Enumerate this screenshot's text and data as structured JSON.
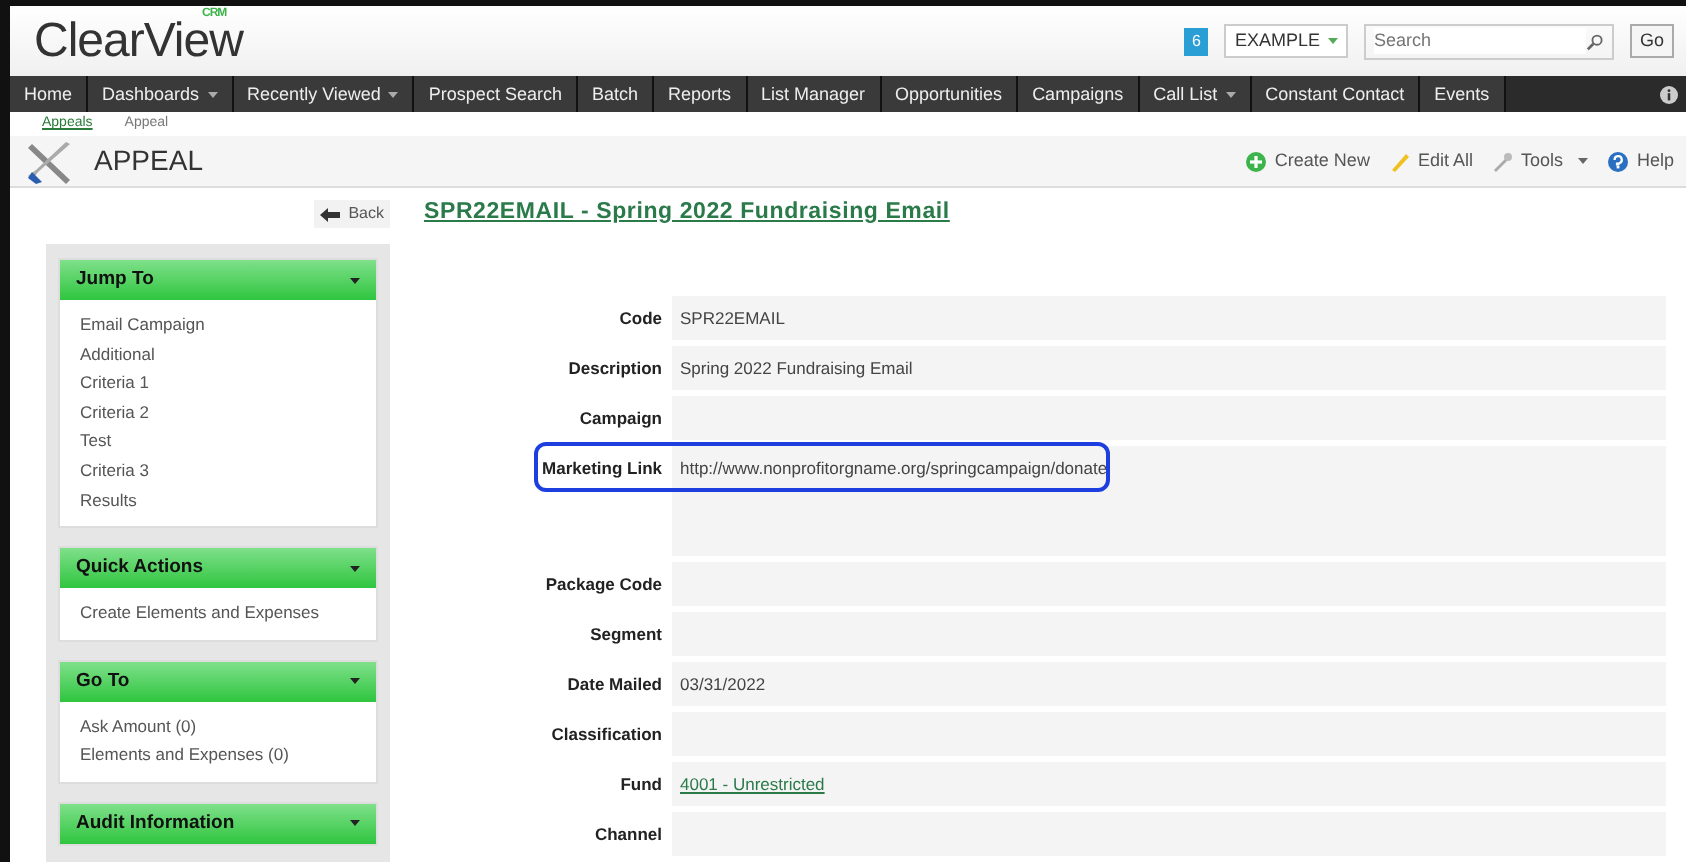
{
  "header": {
    "logo": "ClearView",
    "logo_badge": "CRM",
    "notification_count": "6",
    "org_select": "EXAMPLE",
    "search": {
      "placeholder": "Search"
    },
    "go_button": "Go"
  },
  "nav": [
    {
      "label": "Home",
      "dropdown": false
    },
    {
      "label": "Dashboards",
      "dropdown": true
    },
    {
      "label": "Recently Viewed",
      "dropdown": true
    },
    {
      "label": "Prospect Search",
      "dropdown": false
    },
    {
      "label": "Batch",
      "dropdown": false
    },
    {
      "label": "Reports",
      "dropdown": false
    },
    {
      "label": "List Manager",
      "dropdown": false
    },
    {
      "label": "Opportunities",
      "dropdown": false
    },
    {
      "label": "Campaigns",
      "dropdown": false
    },
    {
      "label": "Call List",
      "dropdown": true
    },
    {
      "label": "Constant Contact",
      "dropdown": false
    },
    {
      "label": "Events",
      "dropdown": false
    }
  ],
  "breadcrumbs": [
    {
      "label": "Appeals",
      "selected": false
    },
    {
      "label": "Appeal",
      "selected": true
    }
  ],
  "page_title": "APPEAL",
  "actions": [
    {
      "label": "Create New",
      "kind": "create",
      "dropdown": false
    },
    {
      "label": "Edit All",
      "kind": "edit",
      "dropdown": false
    },
    {
      "label": "Tools",
      "kind": "tools",
      "dropdown": true
    },
    {
      "label": "Help",
      "kind": "help",
      "dropdown": false
    }
  ],
  "back_button": "Back",
  "panels": [
    {
      "title": "Jump To",
      "items": [
        "Email Campaign",
        "Additional",
        "Criteria 1",
        "Criteria 2",
        "Test",
        "Criteria 3",
        "Results"
      ]
    },
    {
      "title": "Quick Actions",
      "items": [
        "Create Elements and Expenses"
      ]
    },
    {
      "title": "Go To",
      "items": [
        "Ask Amount (0)",
        "Elements and Expenses (0)"
      ]
    },
    {
      "title": "Audit Information"
    }
  ],
  "record_title": "SPR22EMAIL - Spring 2022 Fundraising Email",
  "fields": [
    {
      "label": "Code",
      "value": "SPR22EMAIL",
      "kind": "text",
      "highlighted": false
    },
    {
      "label": "Description",
      "value": "Spring 2022 Fundraising Email",
      "kind": "text",
      "highlighted": false
    },
    {
      "label": "Campaign",
      "kind": "text",
      "highlighted": false
    },
    {
      "label": "Marketing Link",
      "value": "http://www.nonprofitorgname.org/springcampaign/donate",
      "kind": "textarea",
      "highlighted": true
    },
    {
      "label": "Package Code",
      "kind": "text",
      "highlighted": false
    },
    {
      "label": "Segment",
      "kind": "text",
      "highlighted": false
    },
    {
      "label": "Date Mailed",
      "value": "03/31/2022",
      "kind": "text",
      "highlighted": false
    },
    {
      "label": "Classification",
      "kind": "text",
      "highlighted": false
    },
    {
      "label": "Fund",
      "value": "4001 - Unrestricted",
      "kind": "link",
      "highlighted": false
    },
    {
      "label": "Channel",
      "kind": "text",
      "highlighted": false
    }
  ]
}
